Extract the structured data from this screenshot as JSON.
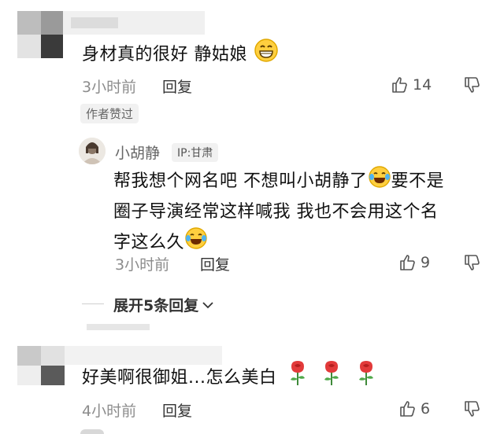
{
  "comments": [
    {
      "text": "身材真的很好 静姑娘",
      "time": "3小时前",
      "reply_label": "回复",
      "likes": "14",
      "author_badge": "作者赞过"
    },
    {
      "username": "小胡静",
      "ip": "IP:甘肃",
      "text_line1": "帮我想个网名吧 不想叫小胡静了",
      "text_line1b": "要不是",
      "text_line2": "圈子导演经常这样喊我 我也不会用这个名",
      "text_line3": "字这么久",
      "time": "3小时前",
      "reply_label": "回复",
      "likes": "9"
    },
    {
      "text": "好美啊很御姐...怎么美白",
      "time": "4小时前",
      "reply_label": "回复",
      "likes": "6"
    }
  ],
  "expand_replies": "展开5条回复",
  "icons": {
    "grin": "grinning-face-icon",
    "laugh": "tears-of-joy-icon",
    "rose": "rose-icon",
    "thumbs_up": "thumbs-up-icon",
    "thumbs_down": "thumbs-down-icon",
    "chevron": "chevron-down-icon"
  },
  "colors": {
    "meta": "#8c8c8c",
    "text": "#111111",
    "badge_bg": "#f1f1f1"
  }
}
